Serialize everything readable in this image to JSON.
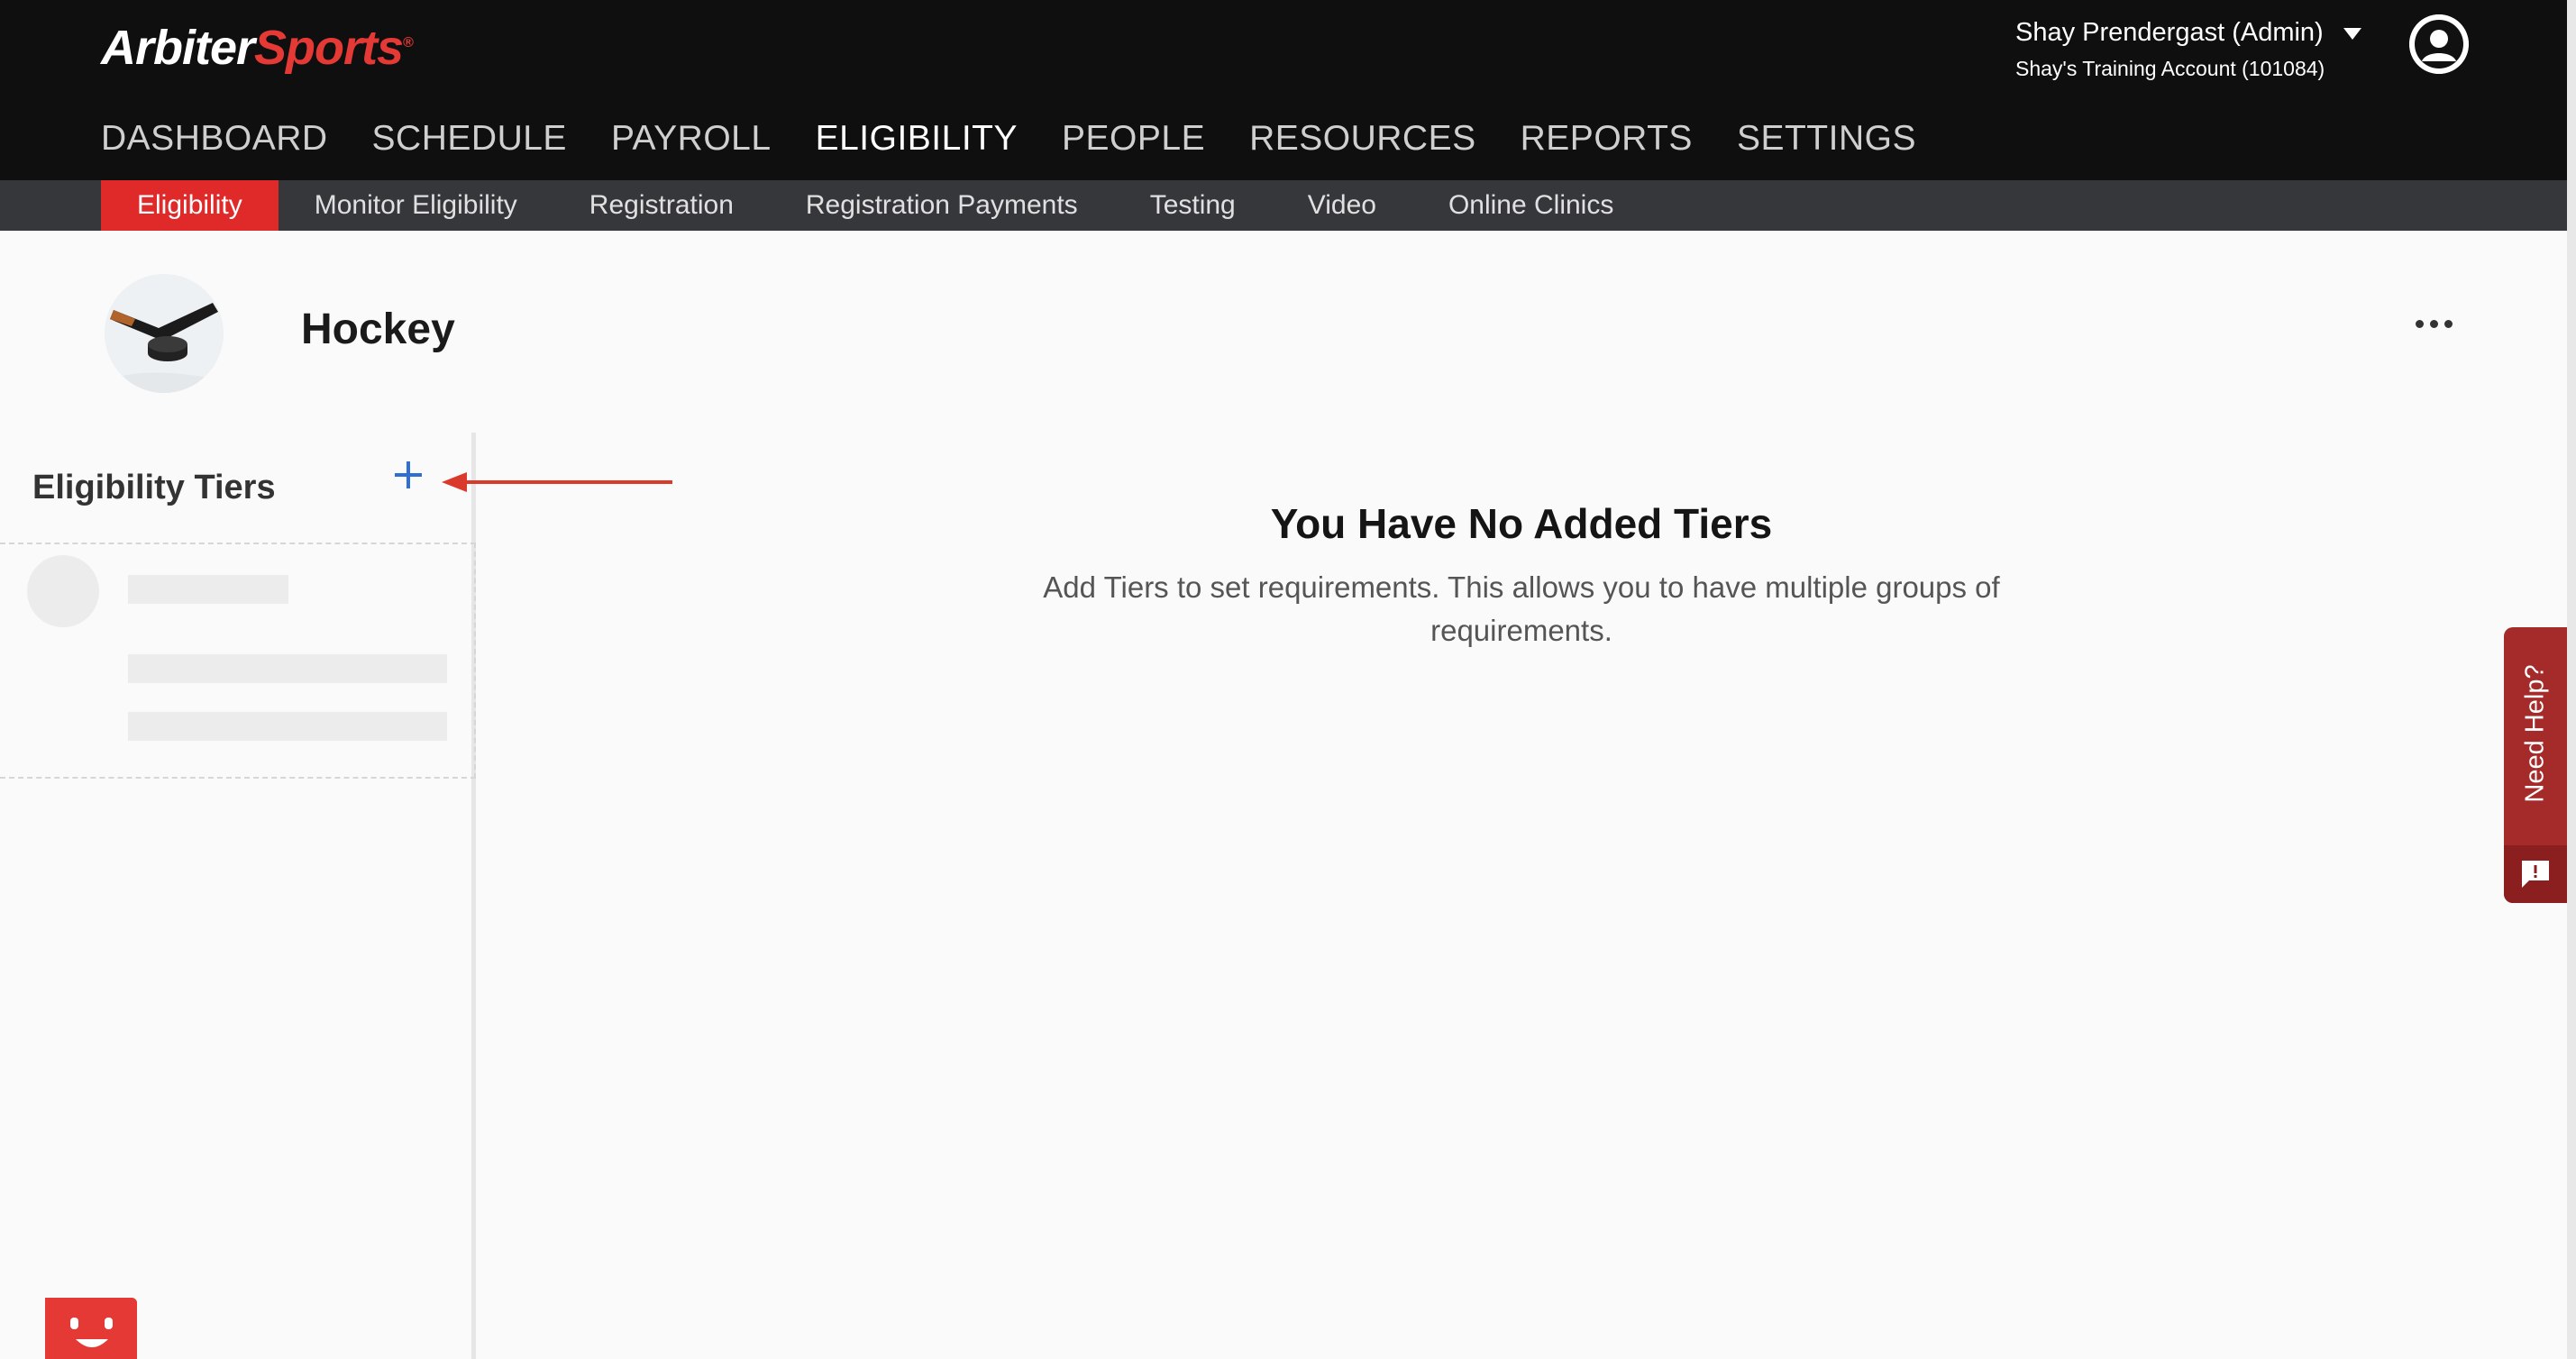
{
  "brand": {
    "logo_left": "Arbiter",
    "logo_right": "Sports",
    "trademark": "®"
  },
  "user": {
    "name": "Shay Prendergast (Admin)",
    "account": "Shay's Training Account (101084)"
  },
  "main_nav": [
    {
      "label": "DASHBOARD"
    },
    {
      "label": "SCHEDULE"
    },
    {
      "label": "PAYROLL"
    },
    {
      "label": "ELIGIBILITY",
      "active": true
    },
    {
      "label": "PEOPLE"
    },
    {
      "label": "RESOURCES"
    },
    {
      "label": "REPORTS"
    },
    {
      "label": "SETTINGS"
    }
  ],
  "sub_nav": [
    {
      "label": "Eligibility",
      "active": true
    },
    {
      "label": "Monitor Eligibility"
    },
    {
      "label": "Registration"
    },
    {
      "label": "Registration Payments"
    },
    {
      "label": "Testing"
    },
    {
      "label": "Video"
    },
    {
      "label": "Online Clinics"
    }
  ],
  "page": {
    "sport_title": "Hockey",
    "sport_icon": "hockey-puck-icon"
  },
  "sidebar": {
    "title": "Eligibility Tiers",
    "add_icon": "plus-icon"
  },
  "empty_state": {
    "heading": "You Have No Added Tiers",
    "message": "Add Tiers to set requirements. This allows you to have multiple groups of requirements."
  },
  "help_tab": {
    "label": "Need Help?",
    "icon": "feedback-icon"
  },
  "colors": {
    "accent_red": "#e02a2a",
    "plus_blue": "#2f6fd1",
    "header_bg": "#0f0f10",
    "subnav_bg": "#36373a",
    "help_bg": "#a52a2a"
  }
}
